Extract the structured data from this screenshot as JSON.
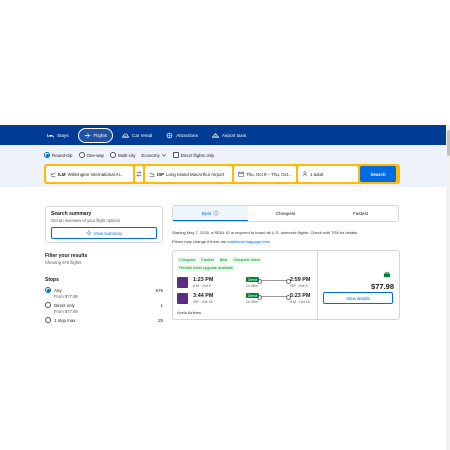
{
  "nav": {
    "items": [
      {
        "label": "Stays",
        "icon": "bed-icon",
        "active": false
      },
      {
        "label": "Flights",
        "icon": "plane-icon",
        "active": true
      },
      {
        "label": "Car rental",
        "icon": "car-icon",
        "active": false
      },
      {
        "label": "Attractions",
        "icon": "attractions-icon",
        "active": false
      },
      {
        "label": "Airport taxis",
        "icon": "taxi-icon",
        "active": false
      }
    ]
  },
  "search": {
    "trip_types": [
      "Round-trip",
      "One-way",
      "Multi-city"
    ],
    "selected_trip": "Round-trip",
    "cabin": "Economy",
    "direct_only_label": "Direct flights only",
    "from_code": "ILM",
    "from_name": "Wilmington International Ar...",
    "to_code": "ISP",
    "to_name": "Long Island MacArthur Airport",
    "dates": "Thu, Oct 9 – Thu, Oct...",
    "travelers": "1 adult",
    "search_label": "Search"
  },
  "sidebar": {
    "summary_title": "Search summary",
    "summary_text": "Get an overview of your flight options",
    "summary_button": "View summary",
    "filter_title": "Filter your results",
    "filter_sub": "Showing 676 flights",
    "stops_title": "Stops",
    "stops": [
      {
        "label": "Any",
        "count": "676",
        "from": "From $77.98",
        "checked": true
      },
      {
        "label": "Direct only",
        "count": "1",
        "from": "From $77.98",
        "checked": false
      },
      {
        "label": "1 stop max",
        "count": "25",
        "from": "",
        "checked": false
      }
    ]
  },
  "results": {
    "tabs": [
      {
        "label": "Best",
        "active": true
      },
      {
        "label": "Cheapest",
        "active": false
      },
      {
        "label": "Fastest",
        "active": false
      }
    ],
    "notice_line1": "Starting May 7, 2025, a REAL ID is required to board all U.S. domestic flights. Check with TSA for details.",
    "notice_line2": "Prices may change if there are",
    "notice_link": "additional baggage fees",
    "flight": {
      "badges": [
        "Cheapest",
        "Fastest",
        "Best",
        "Cheapest direct"
      ],
      "flex_badge": "Flexible ticket upgrade available",
      "legs": [
        {
          "dep_time": "1:23 PM",
          "dep_sub": "ILM · Oct 9",
          "stop": "Direct",
          "duration": "1h 36m",
          "arr_time": "2:59 PM",
          "arr_sub": "ISP · Oct 9"
        },
        {
          "dep_time": "3:44 PM",
          "dep_sub": "ISP · Oct 16",
          "stop": "Direct",
          "duration": "1h 39m",
          "arr_time": "5:23 PM",
          "arr_sub": "ILM · Oct 16"
        }
      ],
      "airline": "Avelo Airlines",
      "price": "$77.98",
      "details_label": "View details"
    }
  },
  "colors": {
    "brand_blue": "#003b95",
    "accent": "#006ce4",
    "search_border": "#febb02",
    "direct_green": "#008234"
  }
}
